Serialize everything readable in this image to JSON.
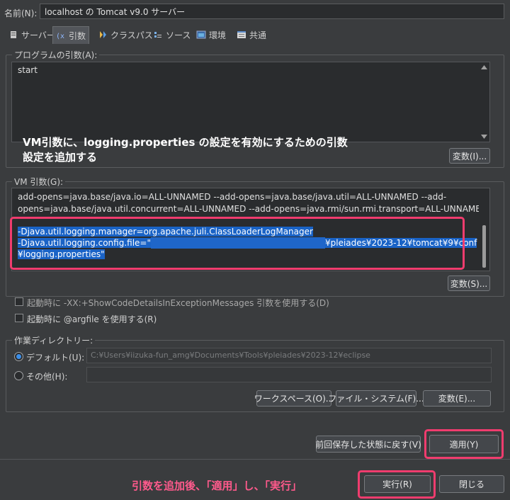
{
  "name": {
    "label": "名前(N):",
    "value": "localhost の Tomcat v9.0 サーバー"
  },
  "tabs": [
    {
      "label": "サーバー",
      "icon": "server-icon"
    },
    {
      "label": "引数",
      "icon": "arguments-icon"
    },
    {
      "label": "クラスパス",
      "icon": "classpath-icon"
    },
    {
      "label": "ソース",
      "icon": "source-icon"
    },
    {
      "label": "環境",
      "icon": "environment-icon"
    },
    {
      "label": "共通",
      "icon": "common-icon"
    }
  ],
  "program_args": {
    "title": "プログラムの引数(A):",
    "value": "start",
    "variables_button": "変数(I)..."
  },
  "annotation_top": {
    "line1": "VM引数に、logging.properties の設定を有効にするための引数",
    "line2": "設定を追加する"
  },
  "vm_args": {
    "title": "VM 引数(G):",
    "line1": "add-opens=java.base/java.io=ALL-UNNAMED --add-opens=java.base/java.util=ALL-UNNAMED --add-",
    "line2": "opens=java.base/java.util.concurrent=ALL-UNNAMED --add-opens=java.rmi/sun.rmi.transport=ALL-UNNAMED",
    "sel1": "-Djava.util.logging.manager=org.apache.juli.ClassLoaderLogManager",
    "sel2a": "-Djava.util.logging.config.file=\"",
    "sel2b": "¥pleiades¥2023-12¥tomcat¥9¥conf",
    "sel3": "¥logging.properties\"",
    "variables_button": "変数(S)..."
  },
  "option1": "起動時に -XX:+ShowCodeDetailsInExceptionMessages 引数を使用する(D)",
  "option2": "起動時に @argfile を使用する(R)",
  "workdir": {
    "title": "作業ディレクトリー:",
    "default_label": "デフォルト(U):",
    "default_value": "C:¥Users¥iizuka-fun_amg¥Documents¥Tools¥pleiades¥2023-12¥eclipse",
    "other_label": "その他(H):",
    "workspace_button": "ワークスペース(O)...",
    "filesystem_button": "ファイル・システム(F)...",
    "variables_button": "変数(E)..."
  },
  "footer": {
    "revert_button": "前回保存した状態に戻す(V)",
    "apply_button": "適用(Y)",
    "run_button": "実行(R)",
    "close_button": "閉じる"
  },
  "annotation_bottom": "引数を追加後、「適用」し、「実行」",
  "colors": {
    "highlight": "#f03c6e",
    "selection": "#1a63c6",
    "annotation_pink": "#ff5a8c"
  }
}
